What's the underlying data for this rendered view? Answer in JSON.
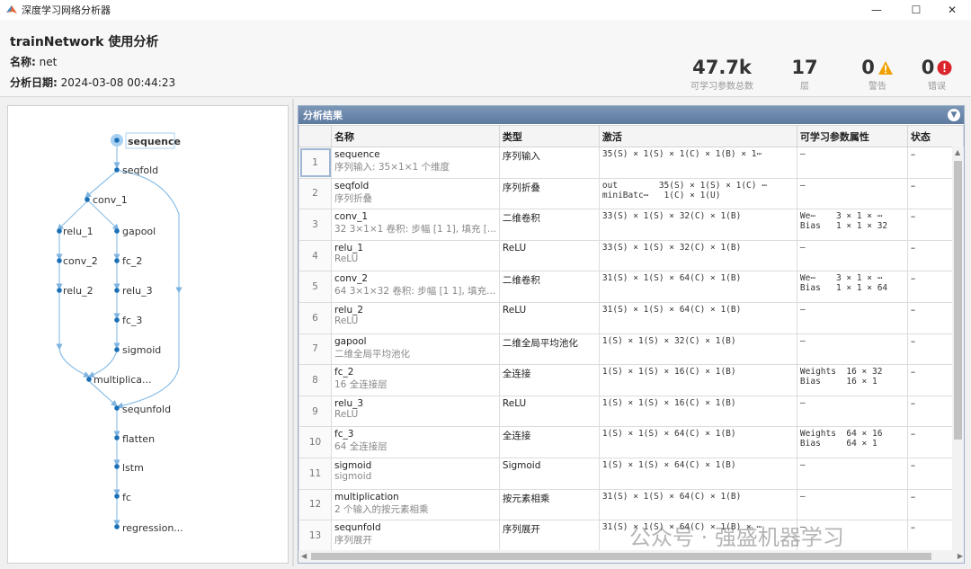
{
  "window": {
    "title": "深度学习网络分析器"
  },
  "header": {
    "title": "trainNetwork 使用分析",
    "name_label": "名称:",
    "name_value": "net",
    "date_label": "分析日期:",
    "date_value": "2024-03-08 00:44:23"
  },
  "stats": [
    {
      "value": "47.7k",
      "label": "可学习参数总数"
    },
    {
      "value": "17",
      "label": "层"
    },
    {
      "value": "0",
      "label": "警告",
      "icon": "warning-icon",
      "color": "#f0a000"
    },
    {
      "value": "0",
      "label": "错误",
      "icon": "error-icon",
      "color": "#d9252b"
    }
  ],
  "graph": {
    "nodes": [
      {
        "label": "sequence"
      },
      {
        "label": "seqfold"
      },
      {
        "label": "conv_1"
      },
      {
        "label": "relu_1"
      },
      {
        "label": "gapool"
      },
      {
        "label": "conv_2"
      },
      {
        "label": "fc_2"
      },
      {
        "label": "relu_2"
      },
      {
        "label": "relu_3"
      },
      {
        "label": "fc_3"
      },
      {
        "label": "sigmoid"
      },
      {
        "label": "multiplica..."
      },
      {
        "label": "sequnfold"
      },
      {
        "label": "flatten"
      },
      {
        "label": "lstm"
      },
      {
        "label": "fc"
      },
      {
        "label": "regression..."
      }
    ]
  },
  "results": {
    "title": "分析结果",
    "columns": [
      "",
      "名称",
      "类型",
      "激活",
      "可学习参数属性",
      "状态"
    ],
    "rows": [
      {
        "idx": "1",
        "name": "sequence",
        "desc": "序列输入: 35×1×1 个维度",
        "type": "序列输入",
        "act": "35(S) × 1(S) × 1(C) × 1(B) × 1⋯",
        "params": "–",
        "status": "–"
      },
      {
        "idx": "2",
        "name": "seqfold",
        "desc": "序列折叠",
        "type": "序列折叠",
        "act": "out        35(S) × 1(S) × 1(C) ⋯\nminiBatc⋯   1(C) × 1(U)",
        "params": "–",
        "status": "–"
      },
      {
        "idx": "3",
        "name": "conv_1",
        "desc": "32 3×1×1 卷积: 步幅 [1 1], 填充 [...",
        "type": "二维卷积",
        "act": "33(S) × 1(S) × 32(C) × 1(B)",
        "params": "We⋯    3 × 1 × ⋯\nBias   1 × 1 × 32",
        "status": "–"
      },
      {
        "idx": "4",
        "name": "relu_1",
        "desc": "ReLU",
        "type": "ReLU",
        "act": "33(S) × 1(S) × 32(C) × 1(B)",
        "params": "–",
        "status": "–"
      },
      {
        "idx": "5",
        "name": "conv_2",
        "desc": "64 3×1×32 卷积: 步幅 [1 1], 填充...",
        "type": "二维卷积",
        "act": "31(S) × 1(S) × 64(C) × 1(B)",
        "params": "We⋯    3 × 1 × ⋯\nBias   1 × 1 × 64",
        "status": "–"
      },
      {
        "idx": "6",
        "name": "relu_2",
        "desc": "ReLU",
        "type": "ReLU",
        "act": "31(S) × 1(S) × 64(C) × 1(B)",
        "params": "–",
        "status": "–"
      },
      {
        "idx": "7",
        "name": "gapool",
        "desc": "二维全局平均池化",
        "type": "二维全局平均池化",
        "act": "1(S) × 1(S) × 32(C) × 1(B)",
        "params": "–",
        "status": "–"
      },
      {
        "idx": "8",
        "name": "fc_2",
        "desc": "16 全连接层",
        "type": "全连接",
        "act": "1(S) × 1(S) × 16(C) × 1(B)",
        "params": "Weights  16 × 32\nBias     16 × 1",
        "status": "–"
      },
      {
        "idx": "9",
        "name": "relu_3",
        "desc": "ReLU",
        "type": "ReLU",
        "act": "1(S) × 1(S) × 16(C) × 1(B)",
        "params": "–",
        "status": "–"
      },
      {
        "idx": "10",
        "name": "fc_3",
        "desc": "64 全连接层",
        "type": "全连接",
        "act": "1(S) × 1(S) × 64(C) × 1(B)",
        "params": "Weights  64 × 16\nBias     64 × 1",
        "status": "–"
      },
      {
        "idx": "11",
        "name": "sigmoid",
        "desc": "sigmoid",
        "type": "Sigmoid",
        "act": "1(S) × 1(S) × 64(C) × 1(B)",
        "params": "–",
        "status": "–"
      },
      {
        "idx": "12",
        "name": "multiplication",
        "desc": "2 个输入的按元素相乘",
        "type": "按元素相乘",
        "act": "31(S) × 1(S) × 64(C) × 1(B)",
        "params": "–",
        "status": "–"
      },
      {
        "idx": "13",
        "name": "sequnfold",
        "desc": "序列展开",
        "type": "序列展开",
        "act": "31(S) × 1(S) × 64(C) × 1(B) × ⋯",
        "params": "–",
        "status": "–"
      }
    ]
  },
  "watermark": "公众号 · 强盛机器学习",
  "window_controls": {
    "minimize": "—",
    "maximize": "☐",
    "close": "✕"
  }
}
